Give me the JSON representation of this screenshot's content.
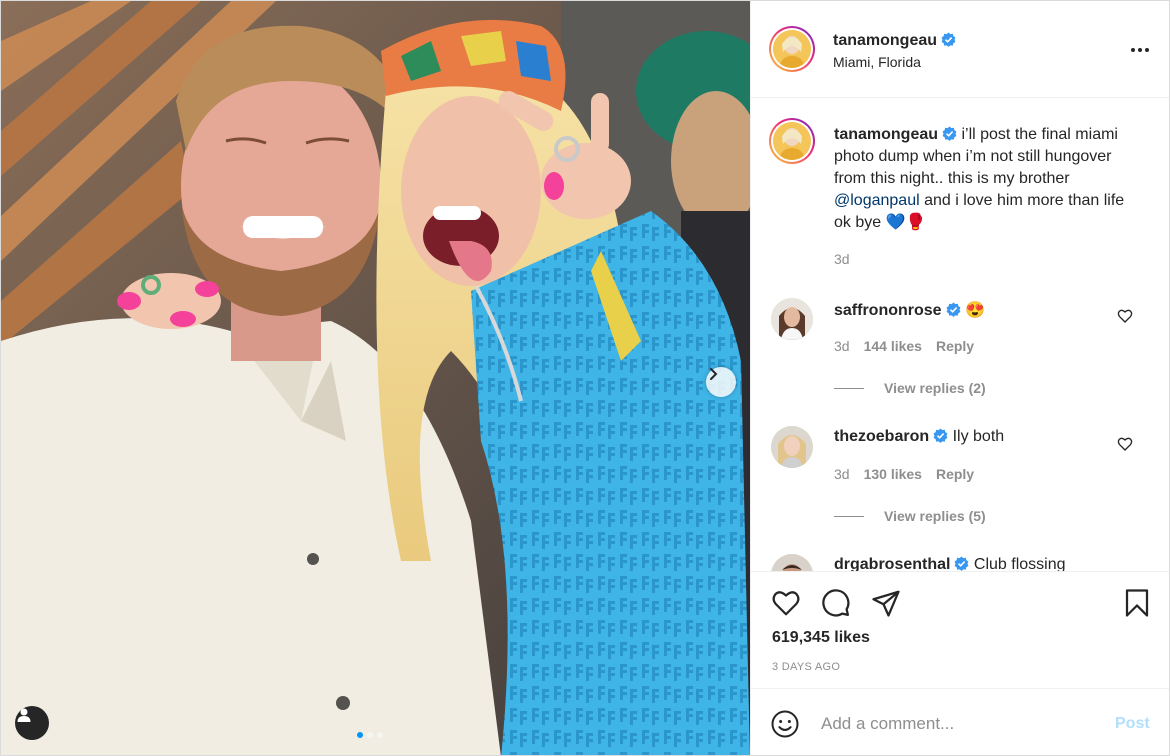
{
  "post": {
    "username": "tanamongeau",
    "location": "Miami, Florida",
    "caption_prefix": "i’ll post the final miami photo dump when i’m not still hungover from this night.. this is my brother ",
    "caption_mention": "@loganpaul",
    "caption_suffix": " and i love him more than life ok bye 💙🥊",
    "caption_time": "3d",
    "likes": "619,345 likes",
    "posted": "3 DAYS AGO",
    "carousel": {
      "count": 3,
      "active": 1
    }
  },
  "comments": [
    {
      "username": "saffrononrose",
      "text": " 😍",
      "time": "3d",
      "likes": "144 likes",
      "reply": "Reply",
      "view_replies": "View replies (2)"
    },
    {
      "username": "thezoebaron",
      "text": " Ily both",
      "time": "3d",
      "likes": "130 likes",
      "reply": "Reply",
      "view_replies": "View replies (5)"
    },
    {
      "username": "drgabrosenthal",
      "text": " Club flossing"
    }
  ],
  "composer": {
    "placeholder": "Add a comment...",
    "post_label": "Post"
  },
  "colors": {
    "verified": "#3897f0",
    "link": "#00376b",
    "post_disabled": "#b2dffc",
    "active_dot": "#0095f6"
  },
  "icons": {
    "like": "heart-icon",
    "comment": "comment-bubble-icon",
    "share": "paper-plane-icon",
    "save": "bookmark-icon",
    "more": "more-horizontal-icon",
    "emoji": "smiley-icon",
    "next": "chevron-right-icon",
    "tags": "user-tag-icon"
  }
}
